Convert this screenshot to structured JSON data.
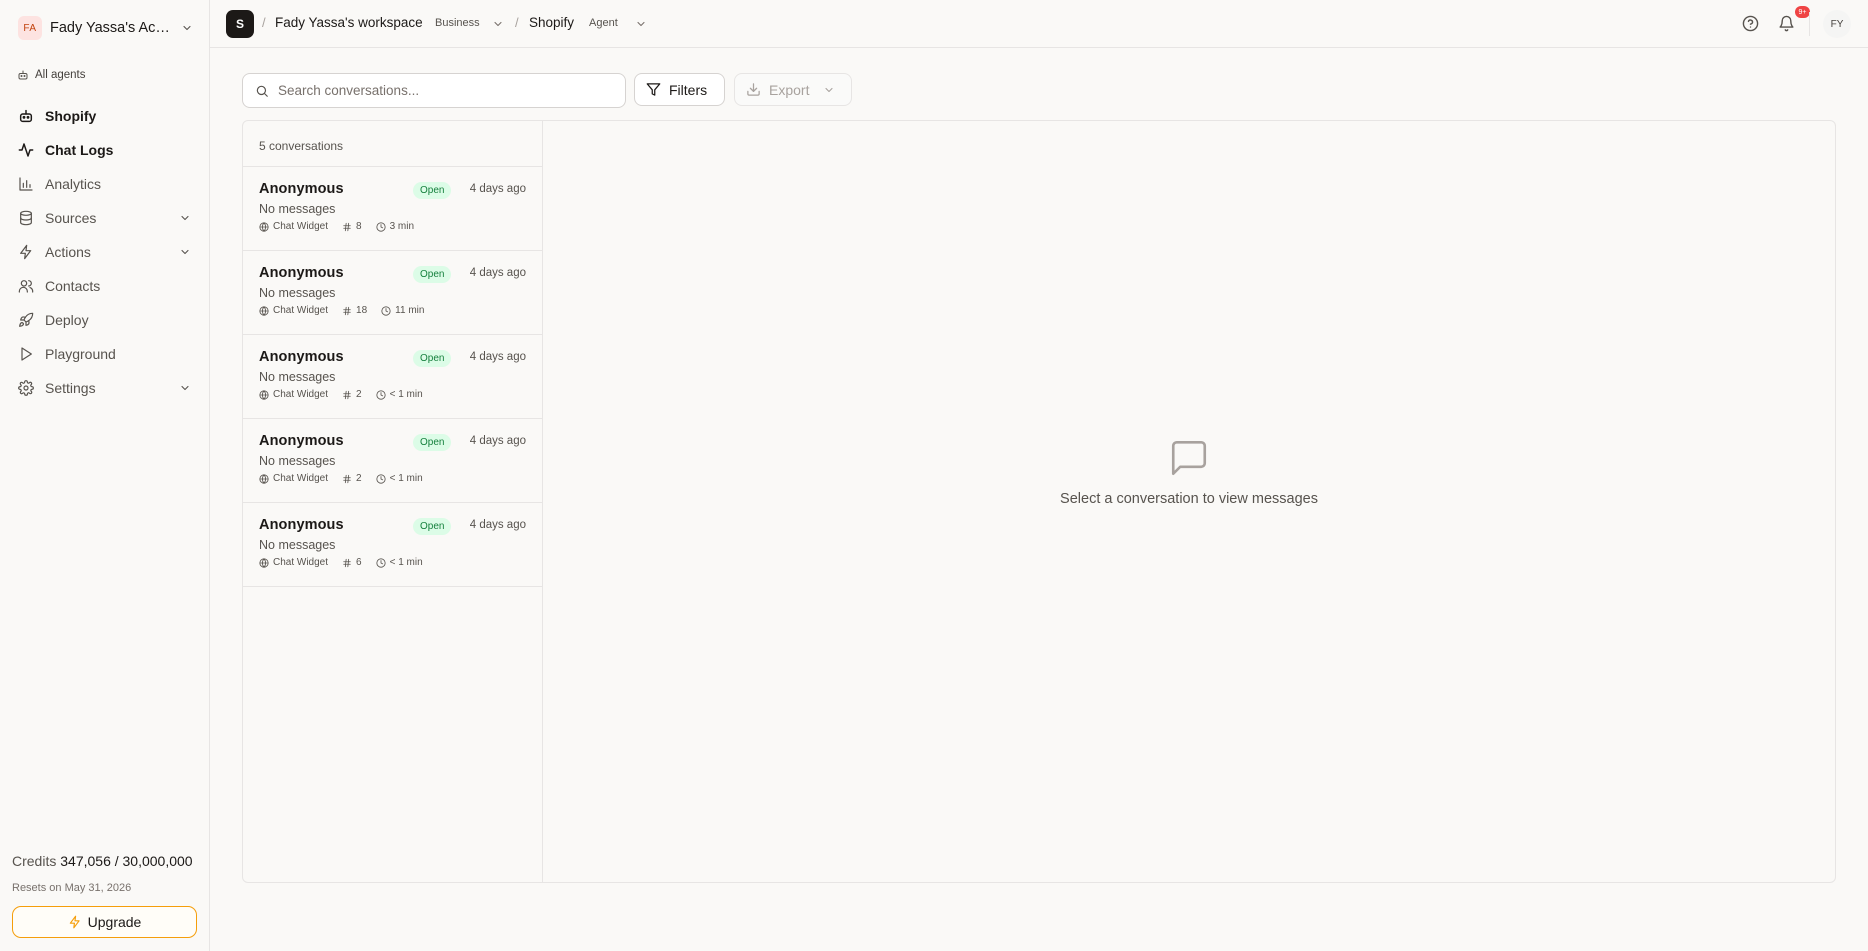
{
  "account": {
    "initials": "FA",
    "name": "Fady Yassa's Acco..."
  },
  "sidebar": {
    "all_agents": "All agents",
    "items": [
      {
        "label": "Shopify",
        "icon": "robot-icon",
        "bold": true,
        "expandable": false
      },
      {
        "label": "Chat Logs",
        "icon": "activity-icon",
        "bold": true,
        "expandable": false
      },
      {
        "label": "Analytics",
        "icon": "bar-chart-icon",
        "bold": false,
        "expandable": false
      },
      {
        "label": "Sources",
        "icon": "database-icon",
        "bold": false,
        "expandable": true
      },
      {
        "label": "Actions",
        "icon": "bolt-icon",
        "bold": false,
        "expandable": true
      },
      {
        "label": "Contacts",
        "icon": "users-icon",
        "bold": false,
        "expandable": false
      },
      {
        "label": "Deploy",
        "icon": "rocket-icon",
        "bold": false,
        "expandable": false
      },
      {
        "label": "Playground",
        "icon": "play-icon",
        "bold": false,
        "expandable": false
      },
      {
        "label": "Settings",
        "icon": "gear-icon",
        "bold": false,
        "expandable": true
      }
    ],
    "credits_label": "Credits",
    "credits_value": "347,056 / 30,000,000",
    "resets": "Resets on May 31, 2026",
    "upgrade_label": "Upgrade"
  },
  "header": {
    "workspace_logo": "S",
    "workspace_name": "Fady Yassa's workspace",
    "workspace_plan": "Business",
    "agent_name": "Shopify",
    "agent_badge": "Agent",
    "notification_count": "9+",
    "user_initials": "FY"
  },
  "toolbar": {
    "search_placeholder": "Search conversations...",
    "filters_label": "Filters",
    "export_label": "Export"
  },
  "conversations": {
    "count_label": "5 conversations",
    "items": [
      {
        "name": "Anonymous",
        "status": "Open",
        "time": "4 days ago",
        "message": "No messages",
        "channel": "Chat Widget",
        "number": "8",
        "duration": "3 min"
      },
      {
        "name": "Anonymous",
        "status": "Open",
        "time": "4 days ago",
        "message": "No messages",
        "channel": "Chat Widget",
        "number": "18",
        "duration": "11 min"
      },
      {
        "name": "Anonymous",
        "status": "Open",
        "time": "4 days ago",
        "message": "No messages",
        "channel": "Chat Widget",
        "number": "2",
        "duration": "< 1 min"
      },
      {
        "name": "Anonymous",
        "status": "Open",
        "time": "4 days ago",
        "message": "No messages",
        "channel": "Chat Widget",
        "number": "2",
        "duration": "< 1 min"
      },
      {
        "name": "Anonymous",
        "status": "Open",
        "time": "4 days ago",
        "message": "No messages",
        "channel": "Chat Widget",
        "number": "6",
        "duration": "< 1 min"
      }
    ]
  },
  "empty_state": {
    "icon": "message-square-icon",
    "text": "Select a conversation to view messages"
  },
  "colors": {
    "accent": "#f59e0b",
    "status_open_bg": "#dcfce7",
    "status_open_text": "#15803d",
    "notification": "#ef4444"
  }
}
